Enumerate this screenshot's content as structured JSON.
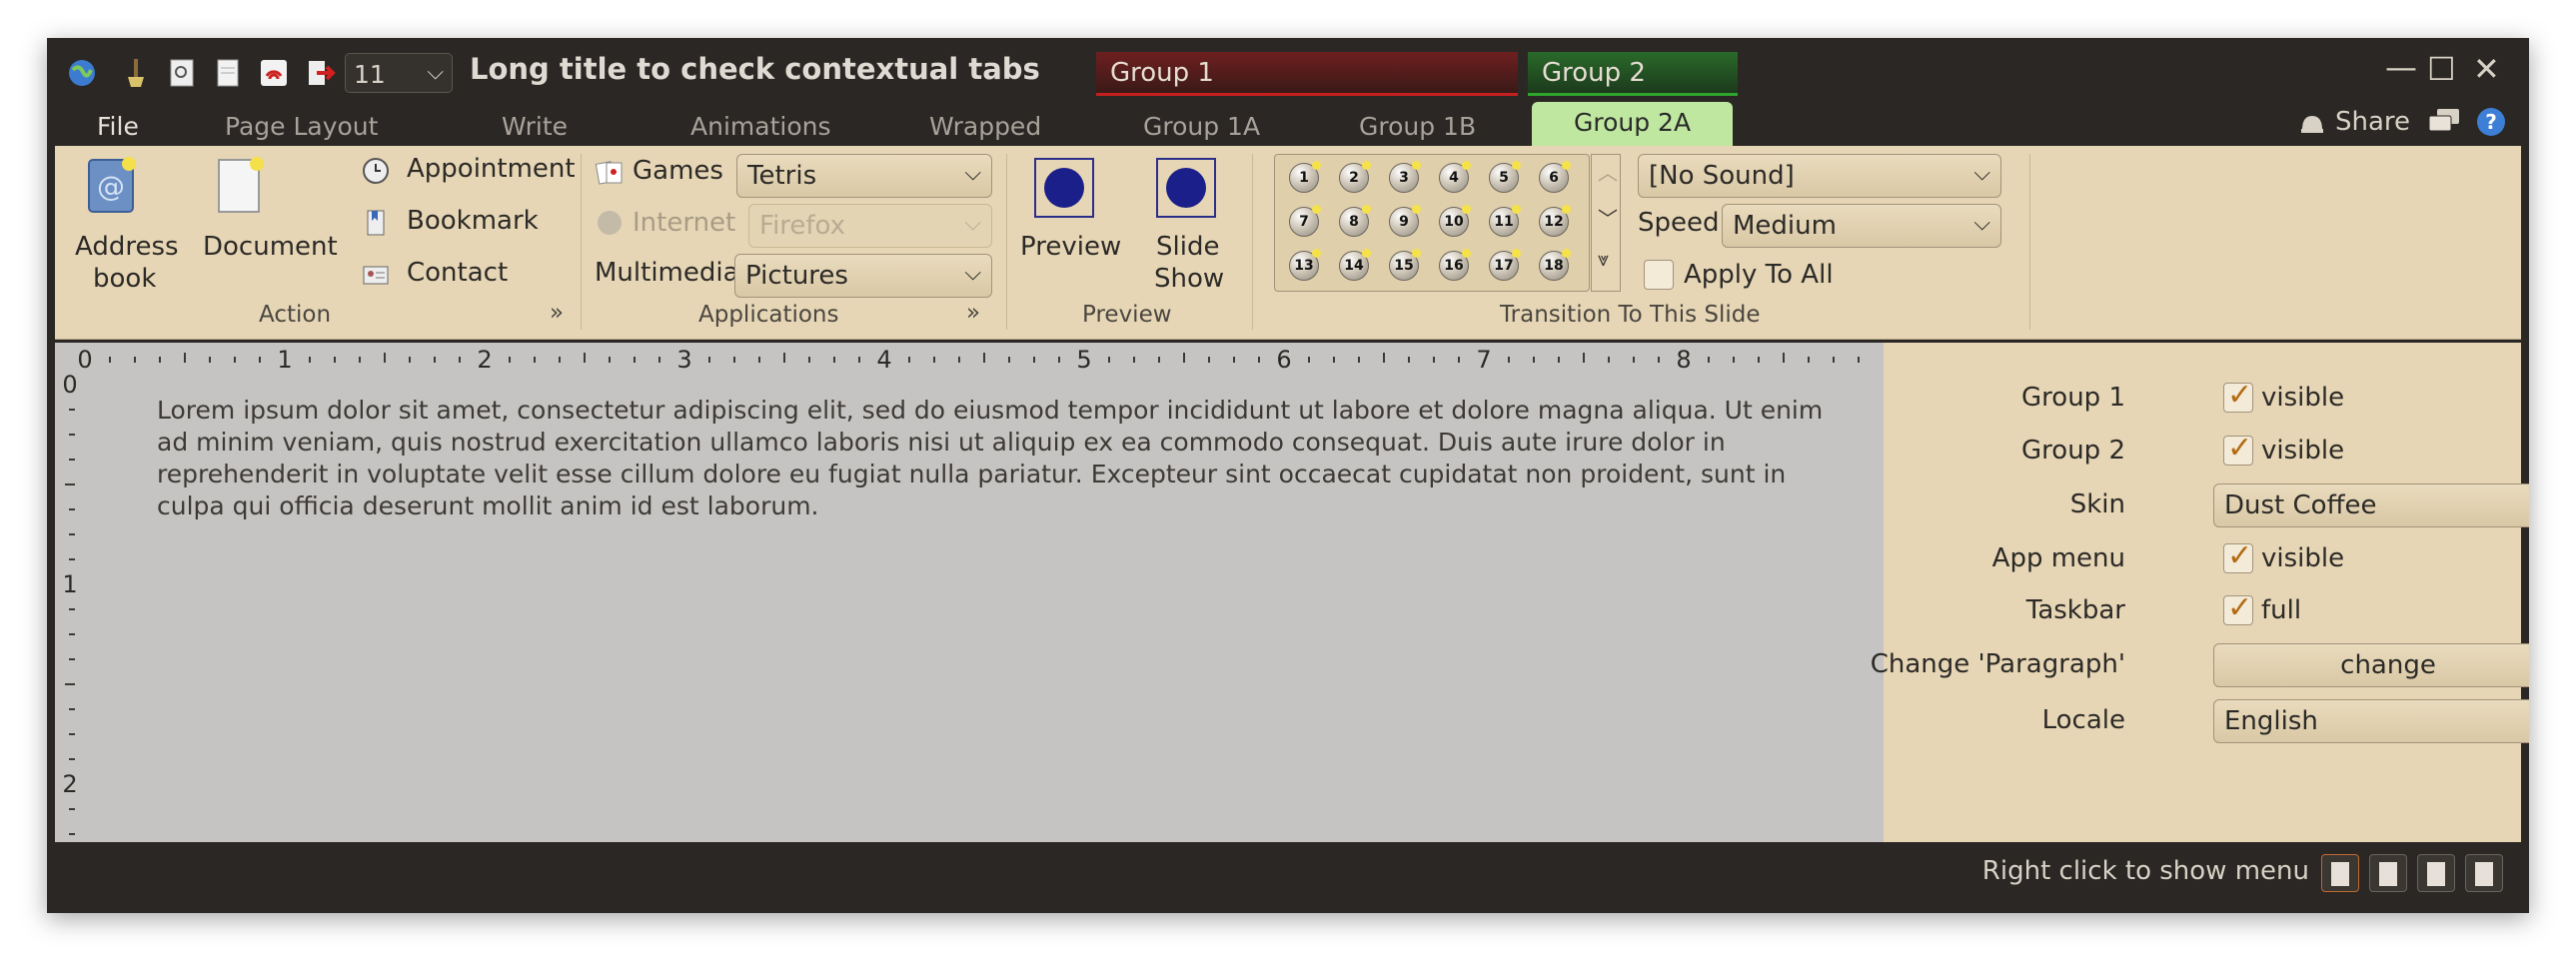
{
  "window": {
    "title": "Long title to check contextual tabs",
    "font_size": "11",
    "group1_label": "Group 1",
    "group2_label": "Group 2",
    "minimize": "—",
    "maximize": "☐",
    "close": "✕"
  },
  "tabs": {
    "file": "File",
    "page_layout": "Page Layout",
    "write": "Write",
    "animations": "Animations",
    "wrapped": "Wrapped",
    "group1a": "Group 1A",
    "group1b": "Group 1B",
    "group2a": "Group 2A",
    "share": "Share"
  },
  "ribbon": {
    "action": {
      "band": "Action",
      "address_book_line1": "Address",
      "address_book_line2": "book",
      "document": "Document",
      "appointment": "Appointment",
      "bookmark": "Bookmark",
      "contact": "Contact"
    },
    "applications": {
      "band": "Applications",
      "games_label": "Games",
      "games_value": "Tetris",
      "internet_label": "Internet",
      "internet_value": "Firefox",
      "multimedia_label": "Multimedia",
      "multimedia_value": "Pictures"
    },
    "preview": {
      "band": "Preview",
      "preview_label": "Preview",
      "slide_show_line1": "Slide",
      "slide_show_line2": "Show"
    },
    "transition": {
      "band": "Transition To This Slide",
      "cells": [
        "1",
        "2",
        "3",
        "4",
        "5",
        "6",
        "7",
        "8",
        "9",
        "10",
        "11",
        "12",
        "13",
        "14",
        "15",
        "16",
        "17",
        "18"
      ],
      "sound_value": "[No Sound]",
      "speed_label": "Speed",
      "speed_value": "Medium",
      "apply_all": "Apply To All"
    }
  },
  "ruler": {
    "h_numbers": [
      "0",
      "1",
      "2",
      "3",
      "4",
      "5",
      "6",
      "7",
      "8"
    ],
    "v_numbers": [
      "0",
      "1",
      "2"
    ]
  },
  "document": {
    "text": "Lorem ipsum dolor sit amet, consectetur adipiscing elit, sed do eiusmod tempor incididunt ut labore et dolore magna aliqua. Ut enim ad minim veniam, quis nostrud exercitation ullamco laboris nisi ut aliquip ex ea commodo consequat. Duis aute irure dolor in reprehenderit in voluptate velit esse cillum dolore eu fugiat nulla pariatur. Excepteur sint occaecat cupidatat non proident, sunt in culpa qui officia deserunt mollit anim id est laborum."
  },
  "side": {
    "group1_label": "Group 1",
    "group1_value": "visible",
    "group2_label": "Group 2",
    "group2_value": "visible",
    "skin_label": "Skin",
    "skin_value": "Dust Coffee",
    "app_menu_label": "App menu",
    "app_menu_value": "visible",
    "taskbar_label": "Taskbar",
    "taskbar_value": "full",
    "change_para_label": "Change 'Paragraph'",
    "change_button": "change",
    "locale_label": "Locale",
    "locale_value": "English"
  },
  "status": {
    "text": "Right click to show menu"
  },
  "colors": {
    "chrome": "#2a2724",
    "ribbon": "#e6d6b5",
    "doc_bg": "#c6c4c2",
    "group1": "#c52020",
    "group2": "#2da52d",
    "active_tab": "#bfe7a0"
  }
}
